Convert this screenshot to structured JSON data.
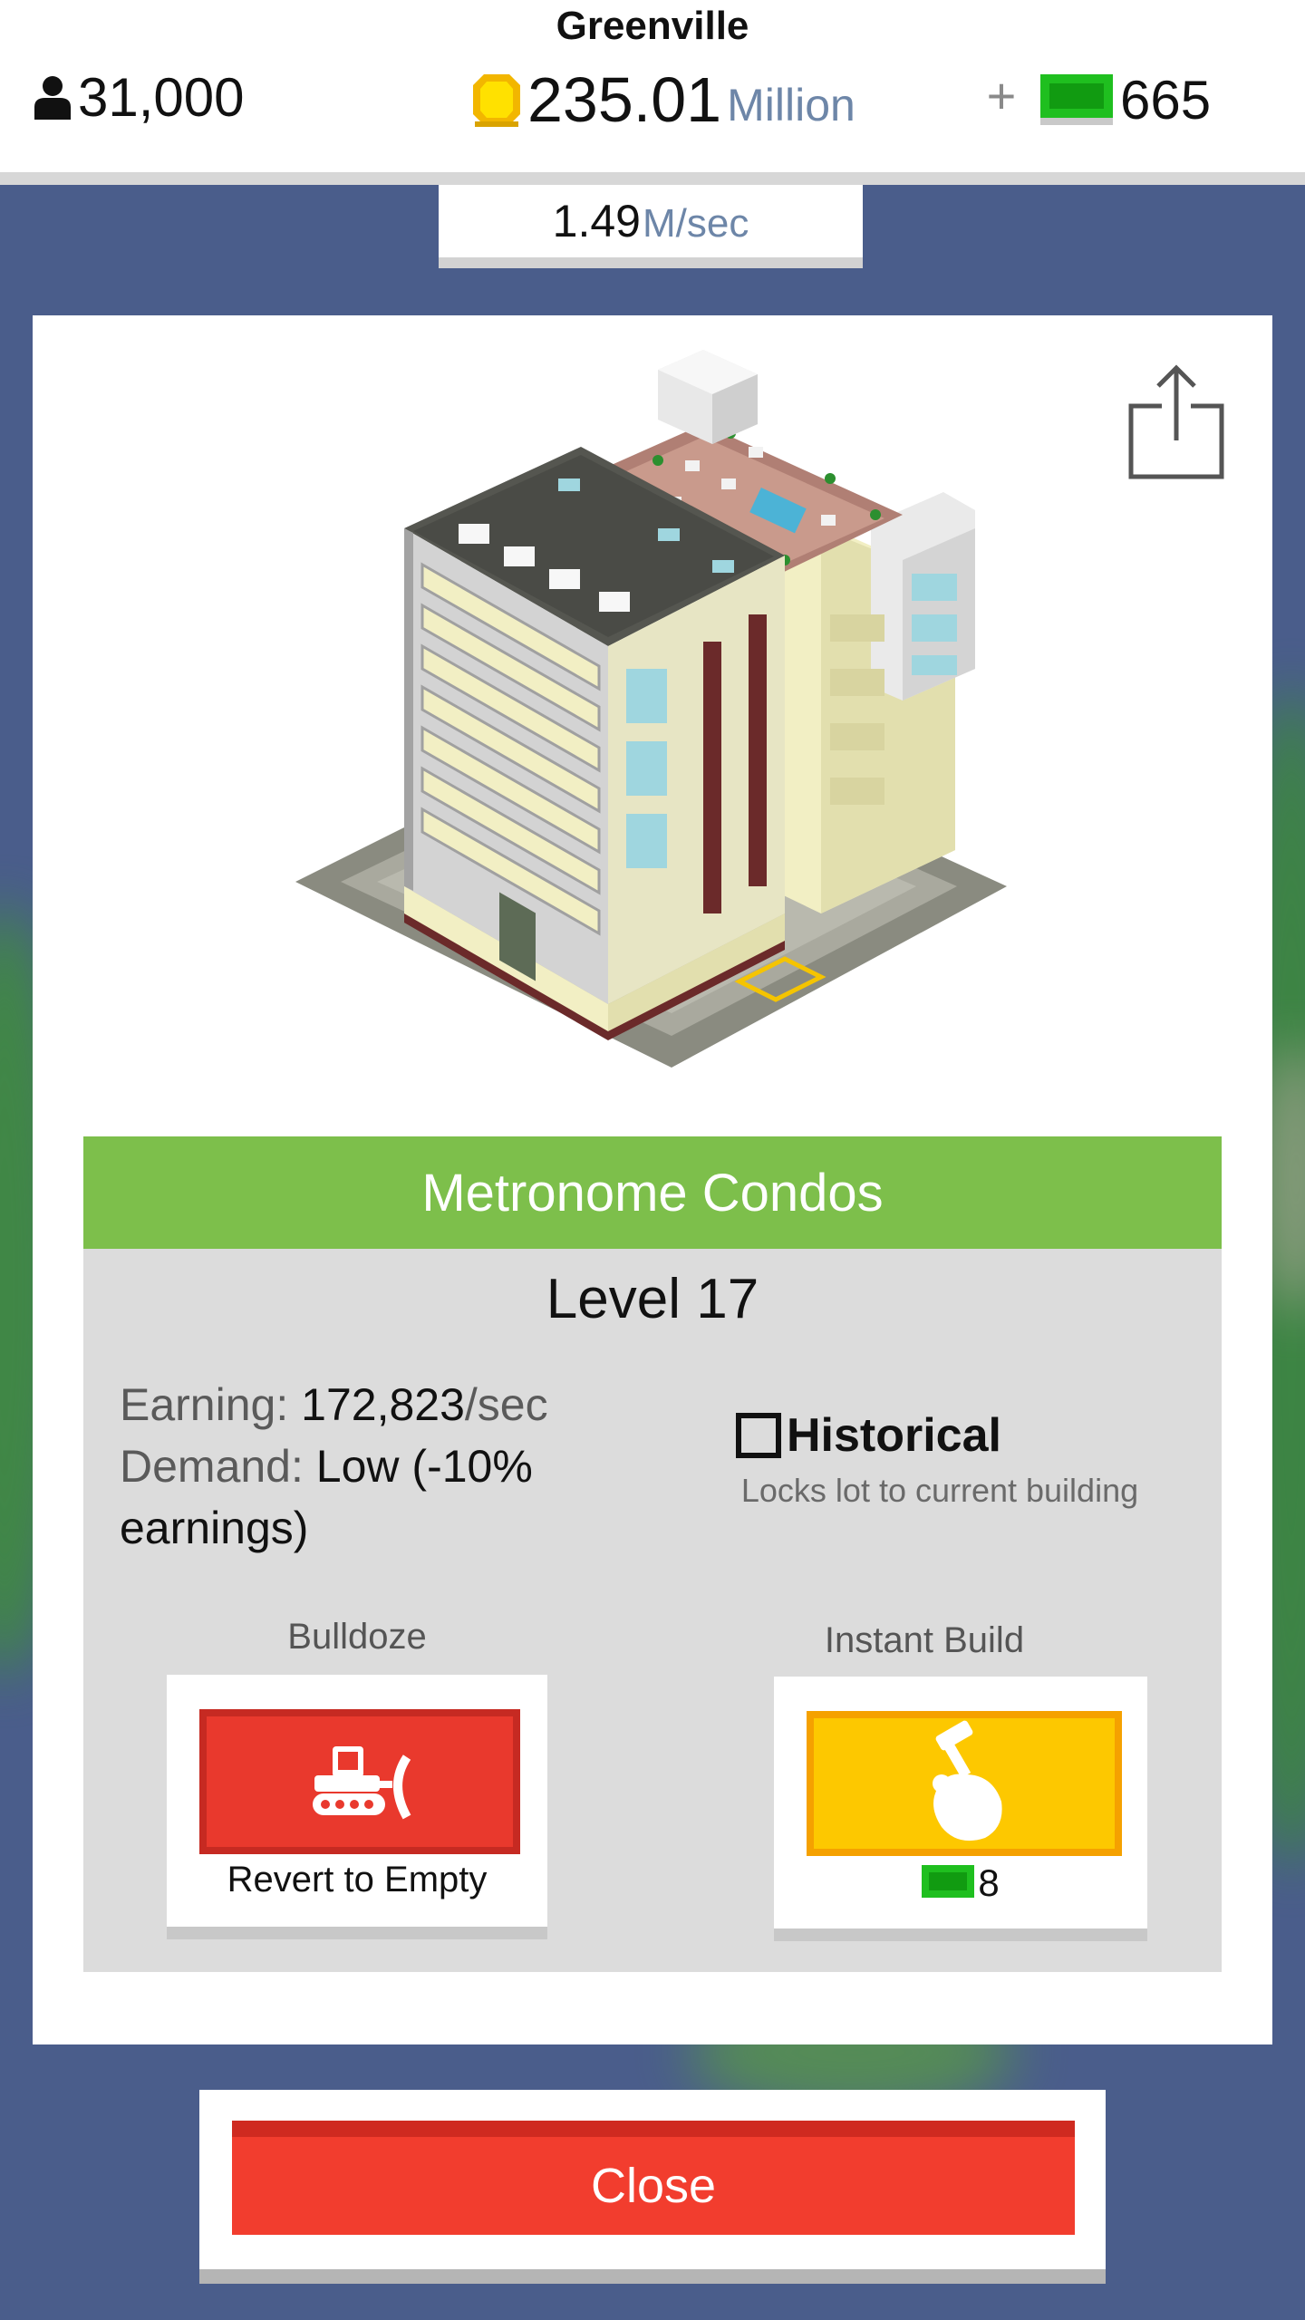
{
  "header": {
    "city_name": "Greenville",
    "population": "31,000",
    "money_value": "235.01",
    "money_unit": "Million",
    "plus_label": "+",
    "cash_value": "665",
    "rate_value": "1.49",
    "rate_unit": "M/sec"
  },
  "building": {
    "name": "Metronome Condos",
    "level": "Level 17",
    "earning_key": "Earning:",
    "earning_value": "172,823",
    "earning_suffix": "/sec",
    "demand_key": "Demand:",
    "demand_value": "Low (-10% earnings)"
  },
  "historical": {
    "label": "Historical",
    "description": "Locks lot to current building",
    "checked": false
  },
  "actions": {
    "bulldoze_label": "Bulldoze",
    "bulldoze_caption": "Revert to Empty",
    "instant_build_label": "Instant Build",
    "instant_build_cost": "8"
  },
  "close_label": "Close",
  "colors": {
    "background": "#4a5d8b",
    "banner_green": "#7dbf4b",
    "bulldoze_red": "#e9392d",
    "instant_yellow": "#fdc800",
    "close_red": "#f23d2e",
    "cash_green": "#1fbf1f"
  },
  "icons": {
    "population": "person-icon",
    "money": "coin-icon",
    "cash": "green-cash-icon",
    "share": "share-icon",
    "bulldoze": "bulldozer-icon",
    "instant_build": "hammer-hand-icon"
  }
}
